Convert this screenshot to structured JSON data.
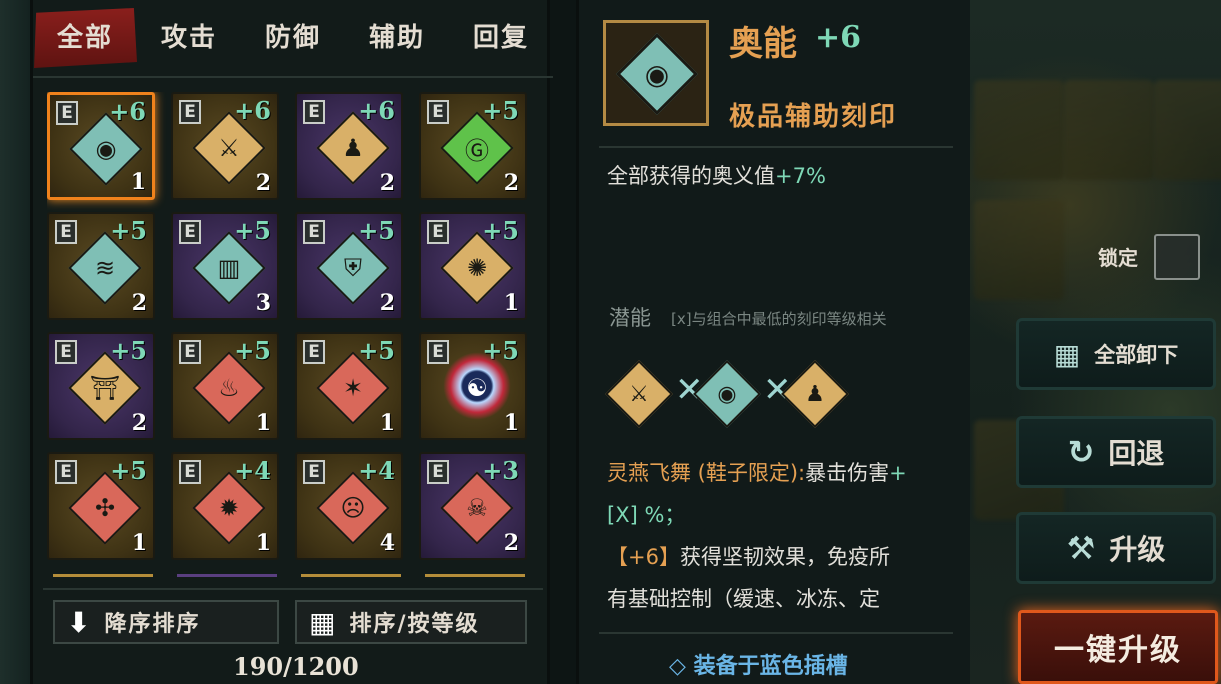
{
  "tabs": [
    "全部",
    "攻击",
    "防御",
    "辅助",
    "回复"
  ],
  "inscriptions": [
    {
      "badge": "E",
      "level": "+6",
      "count": "1",
      "rarity": "gold",
      "color": "teal",
      "glyph": "◉",
      "selected": true
    },
    {
      "badge": "E",
      "level": "+6",
      "count": "2",
      "rarity": "gold",
      "color": "gold",
      "glyph": "⚔"
    },
    {
      "badge": "E",
      "level": "+6",
      "count": "2",
      "rarity": "purple",
      "color": "gold",
      "glyph": "♟"
    },
    {
      "badge": "E",
      "level": "+5",
      "count": "2",
      "rarity": "gold",
      "color": "green",
      "glyph": "Ⓖ"
    },
    {
      "badge": "E",
      "level": "+5",
      "count": "2",
      "rarity": "gold",
      "color": "teal",
      "glyph": "≋"
    },
    {
      "badge": "E",
      "level": "+5",
      "count": "3",
      "rarity": "purple",
      "color": "teal",
      "glyph": "▥"
    },
    {
      "badge": "E",
      "level": "+5",
      "count": "2",
      "rarity": "purple",
      "color": "teal",
      "glyph": "⛨"
    },
    {
      "badge": "E",
      "level": "+5",
      "count": "1",
      "rarity": "purple",
      "color": "gold",
      "glyph": "✺"
    },
    {
      "badge": "E",
      "level": "+5",
      "count": "2",
      "rarity": "purple",
      "color": "gold",
      "glyph": "⛩"
    },
    {
      "badge": "E",
      "level": "+5",
      "count": "1",
      "rarity": "gold",
      "color": "red",
      "glyph": "♨"
    },
    {
      "badge": "E",
      "level": "+5",
      "count": "1",
      "rarity": "gold",
      "color": "red",
      "glyph": "✶"
    },
    {
      "badge": "E",
      "level": "+5",
      "count": "1",
      "rarity": "gold",
      "color": "orb",
      "glyph": "☯"
    },
    {
      "badge": "E",
      "level": "+5",
      "count": "1",
      "rarity": "gold",
      "color": "red",
      "glyph": "✣"
    },
    {
      "badge": "E",
      "level": "+4",
      "count": "1",
      "rarity": "gold",
      "color": "red",
      "glyph": "✹"
    },
    {
      "badge": "E",
      "level": "+4",
      "count": "4",
      "rarity": "gold",
      "color": "red",
      "glyph": "☹"
    },
    {
      "badge": "E",
      "level": "+3",
      "count": "2",
      "rarity": "purple",
      "color": "red",
      "glyph": "☠"
    }
  ],
  "sort": {
    "order_label": "降序排序",
    "by_label": "排序/按等级"
  },
  "capacity": "190/1200",
  "detail": {
    "name": "奥能",
    "level": "+6",
    "subtitle": "极品辅助刻印",
    "effect_prefix": "全部获得的奥义值",
    "effect_bonus": "+7%",
    "potential_label": "潜能",
    "potential_hint": "[x]与组合中最低的刻印等级相关",
    "desc_name": "灵燕飞舞 (鞋子限定):",
    "desc_line1": "暴击伤害",
    "desc_plus": "+",
    "desc_line2": "[X] %；",
    "desc_level_tag": "【+6】",
    "desc_line3": "获得坚韧效果，免疫所",
    "desc_line4": "有基础控制（缓速、冰冻、定",
    "equip_slot": "◇ 装备于蓝色插槽"
  },
  "right": {
    "lock_label": "锁定",
    "unequip_all": "全部卸下",
    "revert": "回退",
    "upgrade": "升级",
    "upgrade_all": "一键升级"
  },
  "colors": {
    "accent_orange": "#e5a052",
    "accent_green": "#7ed8b6",
    "tab_active": "#8a1f1c",
    "slot_blue": "#6ab5e6"
  }
}
